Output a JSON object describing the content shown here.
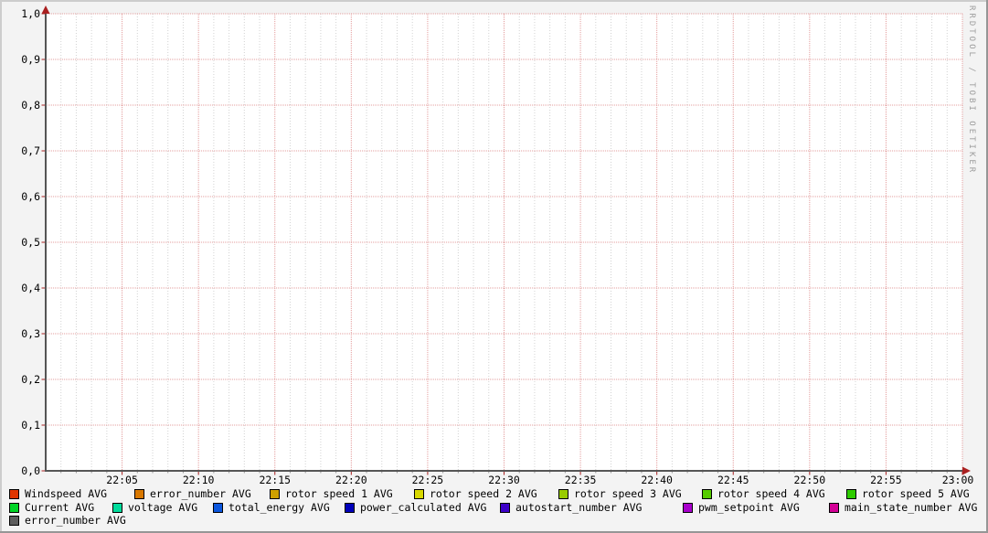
{
  "watermark": "RRDTOOL / TOBI OETIKER",
  "colors": {
    "background": "#f3f3f3",
    "canvas": "#ffffff",
    "border_highlight": "#cdcdcd",
    "border_shadow": "#969696",
    "axis": "#555555",
    "arrow": "#aa2020",
    "major_grid": "#e39c9c",
    "minor_grid": "#d2d2d2",
    "tick_minor": "#999999",
    "label_text": "#000000",
    "watermark_text": "#9d9d9d",
    "swatch_border": "#000000"
  },
  "chart_data": {
    "type": "line",
    "title": "",
    "xlabel": "",
    "ylabel": "",
    "ylim": [
      0.0,
      1.0
    ],
    "y_tick_step": 0.1,
    "y_tick_labels": [
      "1,0",
      "0,9",
      "0,8",
      "0,7",
      "0,6",
      "0,5",
      "0,4",
      "0,3",
      "0,2",
      "0,1",
      "0,0"
    ],
    "x_tick_labels": [
      "22:05",
      "22:10",
      "22:15",
      "22:20",
      "22:25",
      "22:30",
      "22:35",
      "22:40",
      "22:45",
      "22:50",
      "22:55",
      "23:00"
    ],
    "x_minor_ticks_per_major": 5,
    "grid": true,
    "legend_position": "bottom-left",
    "series": [
      {
        "name": "Windspeed AVG",
        "color": "#e03400",
        "values": []
      },
      {
        "name": "error_number AVG",
        "color": "#d97800",
        "values": []
      },
      {
        "name": "rotor speed 1 AVG",
        "color": "#cfa000",
        "values": []
      },
      {
        "name": "rotor speed 2 AVG",
        "color": "#d8d800",
        "values": []
      },
      {
        "name": "rotor speed 3 AVG",
        "color": "#99cc00",
        "values": []
      },
      {
        "name": "rotor speed 4 AVG",
        "color": "#55cc00",
        "values": []
      },
      {
        "name": "rotor speed 5 AVG",
        "color": "#2ecc00",
        "values": []
      },
      {
        "name": "Current AVG",
        "color": "#00d426",
        "values": []
      },
      {
        "name": "voltage AVG",
        "color": "#00dc9c",
        "values": []
      },
      {
        "name": "total_energy AVG",
        "color": "#0b56dd",
        "values": []
      },
      {
        "name": "power_calculated AVG",
        "color": "#0000bb",
        "values": []
      },
      {
        "name": "autostart_number AVG",
        "color": "#3c00c8",
        "values": []
      },
      {
        "name": "pwm_setpoint AVG",
        "color": "#a800cc",
        "values": []
      },
      {
        "name": "main_state_number AVG",
        "color": "#d40096",
        "values": []
      },
      {
        "name": "error_number AVG",
        "color": "#5e5e5e",
        "values": []
      }
    ],
    "legend_rows": [
      [
        0,
        1,
        2,
        3,
        4,
        5,
        6
      ],
      [
        7,
        8,
        9,
        10,
        11,
        12,
        13
      ],
      [
        14
      ]
    ]
  }
}
